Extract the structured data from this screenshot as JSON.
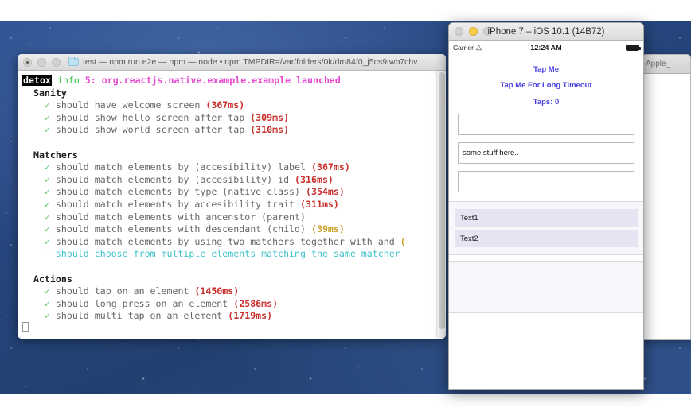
{
  "desktop": {
    "wallpaper_name": "starfield-wallpaper"
  },
  "terminal": {
    "title": "test — npm run e2e — npm — node • npm TMPDIR=/var/folders/0k/dm84f0_j5cs9twb7chv",
    "folder_icon": "folder-icon",
    "log_tag": "detox",
    "log_level": "info",
    "log_message": "5: org.reactjs.native.example.example launched",
    "check_glyph": "✓",
    "pending_glyph": "−",
    "suites": [
      {
        "name": "Sanity",
        "tests": [
          {
            "status": "pass",
            "label": "should have welcome screen",
            "duration": "(367ms)",
            "duration_level": "slow"
          },
          {
            "status": "pass",
            "label": "should show hello screen after tap",
            "duration": "(309ms)",
            "duration_level": "slow"
          },
          {
            "status": "pass",
            "label": "should show world screen after tap",
            "duration": "(310ms)",
            "duration_level": "slow"
          }
        ]
      },
      {
        "name": "Matchers",
        "tests": [
          {
            "status": "pass",
            "label": "should match elements by (accesibility) label",
            "duration": "(367ms)",
            "duration_level": "slow"
          },
          {
            "status": "pass",
            "label": "should match elements by (accesibility) id",
            "duration": "(316ms)",
            "duration_level": "slow"
          },
          {
            "status": "pass",
            "label": "should match elements by type (native class)",
            "duration": "(354ms)",
            "duration_level": "slow"
          },
          {
            "status": "pass",
            "label": "should match elements by accesibility trait",
            "duration": "(311ms)",
            "duration_level": "slow"
          },
          {
            "status": "pass",
            "label": "should match elements with ancenstor (parent)",
            "duration": "",
            "duration_level": "none"
          },
          {
            "status": "pass",
            "label": "should match elements with descendant (child)",
            "duration": "(39ms)",
            "duration_level": "medium"
          },
          {
            "status": "pass",
            "label": "should match elements by using two matchers together with and",
            "duration": "(",
            "duration_level": "medium"
          },
          {
            "status": "pending",
            "label": "should choose from multiple elements matching the same matcher",
            "duration": "",
            "duration_level": "none"
          }
        ]
      },
      {
        "name": "Actions",
        "tests": [
          {
            "status": "pass",
            "label": "should tap on an element",
            "duration": "(1450ms)",
            "duration_level": "slow"
          },
          {
            "status": "pass",
            "label": "should long press on an element",
            "duration": "(2586ms)",
            "duration_level": "slow"
          },
          {
            "status": "pass",
            "label": "should multi tap on an element",
            "duration": "(1719ms)",
            "duration_level": "slow"
          }
        ]
      }
    ],
    "colors": {
      "pass_check": "#5ecb6b",
      "pending": "#3fc3c9",
      "slow_duration": "#c9302c",
      "medium_duration": "#c9a227",
      "info": "#35c246",
      "message": "#e64ad1"
    }
  },
  "background_window": {
    "tab_label": "Apple_"
  },
  "simulator": {
    "window_title": "iPhone 7 – iOS 10.1 (14B72)",
    "traffic_lights": [
      "close",
      "minimize",
      "zoom"
    ],
    "active_light": "minimize",
    "status_bar": {
      "carrier": "Carrier",
      "wifi_icon": "wifi-icon",
      "time": "12:24 AM",
      "battery_icon": "battery-icon"
    },
    "app": {
      "tap_button": "Tap Me",
      "long_timeout_button": "Tap Me For Long Timeout",
      "taps_counter": "Taps: 0",
      "inputs": [
        {
          "name": "input-1",
          "value": "",
          "placeholder": ""
        },
        {
          "name": "input-2",
          "value": "some stuff here..",
          "placeholder": ""
        },
        {
          "name": "input-3",
          "value": "",
          "placeholder": ""
        }
      ],
      "list_items": [
        "Text1",
        "Text2"
      ]
    }
  }
}
